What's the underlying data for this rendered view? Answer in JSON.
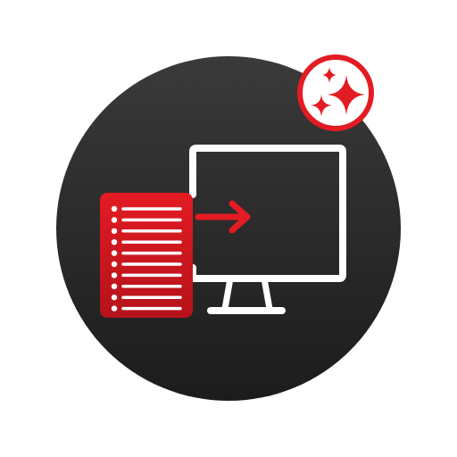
{
  "icon": {
    "meaning": "document-to-monitor-with-sparkles",
    "parts": [
      "list-document-icon",
      "arrow-right-icon",
      "monitor-icon",
      "sparkles-icon"
    ],
    "colors": {
      "background_circle_top": "#3a3a3a",
      "background_circle_bottom": "#1c1c1c",
      "accent_red": "#e31b23",
      "accent_red_dark": "#b5121b",
      "line_white": "#ffffff",
      "page_background": "#ffffff"
    }
  }
}
